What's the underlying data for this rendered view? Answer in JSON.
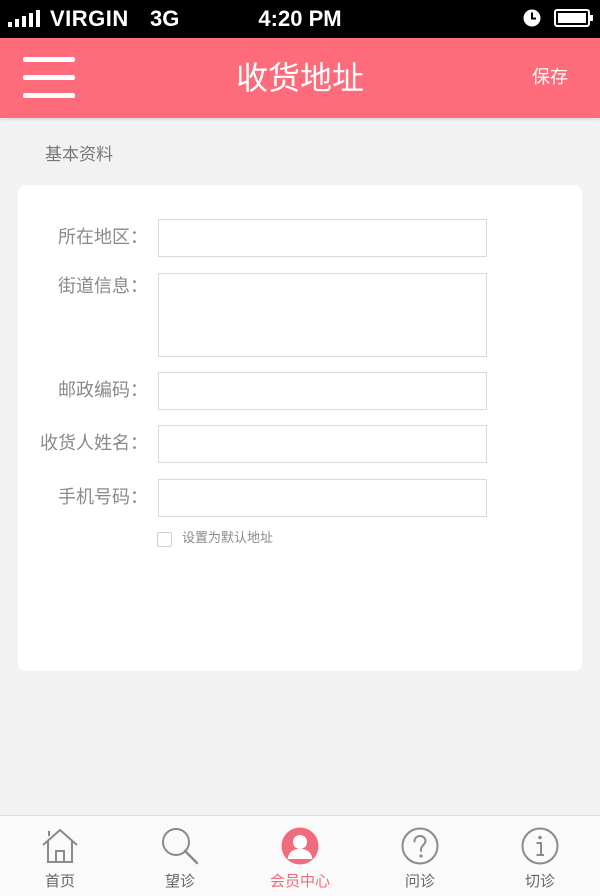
{
  "status_bar": {
    "carrier": "VIRGIN",
    "network": "3G",
    "time": "4:20 PM"
  },
  "header": {
    "title": "收货地址",
    "save_label": "保存"
  },
  "section": {
    "title": "基本资料"
  },
  "form": {
    "fields": [
      {
        "label": "所在地区：",
        "value": ""
      },
      {
        "label": "街道信息：",
        "value": ""
      },
      {
        "label": "邮政编码：",
        "value": ""
      },
      {
        "label": "收货人姓名：",
        "value": ""
      },
      {
        "label": "手机号码：",
        "value": ""
      }
    ],
    "default_checkbox": {
      "label": "设置为默认地址",
      "checked": false
    }
  },
  "tab_bar": {
    "tabs": [
      {
        "label": "首页",
        "icon": "home-icon",
        "active": false
      },
      {
        "label": "望诊",
        "icon": "search-icon",
        "active": false
      },
      {
        "label": "会员中心",
        "icon": "user-icon",
        "active": true
      },
      {
        "label": "问诊",
        "icon": "question-icon",
        "active": false
      },
      {
        "label": "切诊",
        "icon": "info-icon",
        "active": false
      }
    ]
  },
  "colors": {
    "accent": "#fe6b7a",
    "active_tab": "#f06b7b",
    "background": "#f2f2f2"
  }
}
